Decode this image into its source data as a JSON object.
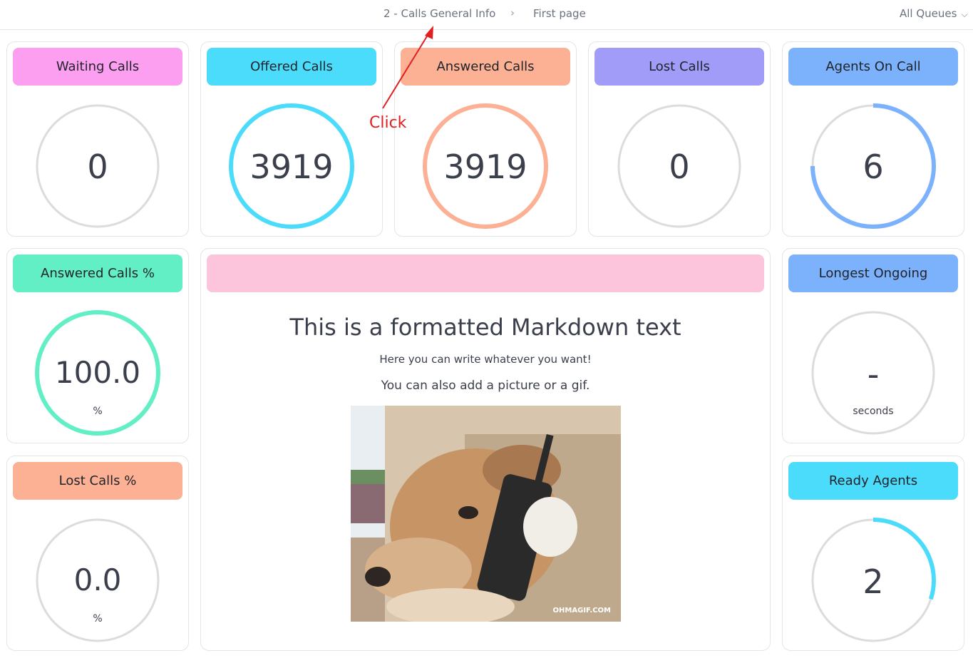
{
  "topbar": {
    "crumb_dashboard": "2 - Calls General Info",
    "crumb_separator": "›",
    "crumb_page": "First page",
    "queue_selector": "All Queues",
    "queue_chevron": "⌵"
  },
  "widgets": {
    "waiting_calls": {
      "title": "Waiting Calls",
      "value": "0",
      "color": "#fc9ff0"
    },
    "offered_calls": {
      "title": "Offered Calls",
      "value": "3919",
      "color": "#4cdcfb"
    },
    "answered_calls": {
      "title": "Answered Calls",
      "value": "3919",
      "color": "#fcb094"
    },
    "lost_calls": {
      "title": "Lost Calls",
      "value": "0",
      "color": "#a29cf9"
    },
    "agents_on_call": {
      "title": "Agents On Call",
      "value": "6",
      "color": "#7cb1fb",
      "gauge_fill": 0.75
    },
    "answered_calls_pct": {
      "title": "Answered Calls %",
      "value": "100.0",
      "unit": "%",
      "color": "#63efc6"
    },
    "lost_calls_pct": {
      "title": "Lost Calls %",
      "value": "0.0",
      "unit": "%",
      "color": "#fcb094"
    },
    "longest_ongoing": {
      "title": "Longest Ongoing",
      "value": "-",
      "unit": "seconds",
      "color": "#7cb1fb"
    },
    "ready_agents": {
      "title": "Ready Agents",
      "value": "2",
      "color": "#4cdcfb",
      "gauge_fill": 0.3
    }
  },
  "markdown_widget": {
    "header_color": "#fdc5dc",
    "heading": "This is a formatted Markdown text",
    "paragraph_1": "Here you can write whatever you want!",
    "paragraph_2": "You can also add a picture or a gif.",
    "image_watermark": "OHMAGIF.COM"
  },
  "annotation": {
    "label": "Click",
    "color": "#e02020"
  }
}
